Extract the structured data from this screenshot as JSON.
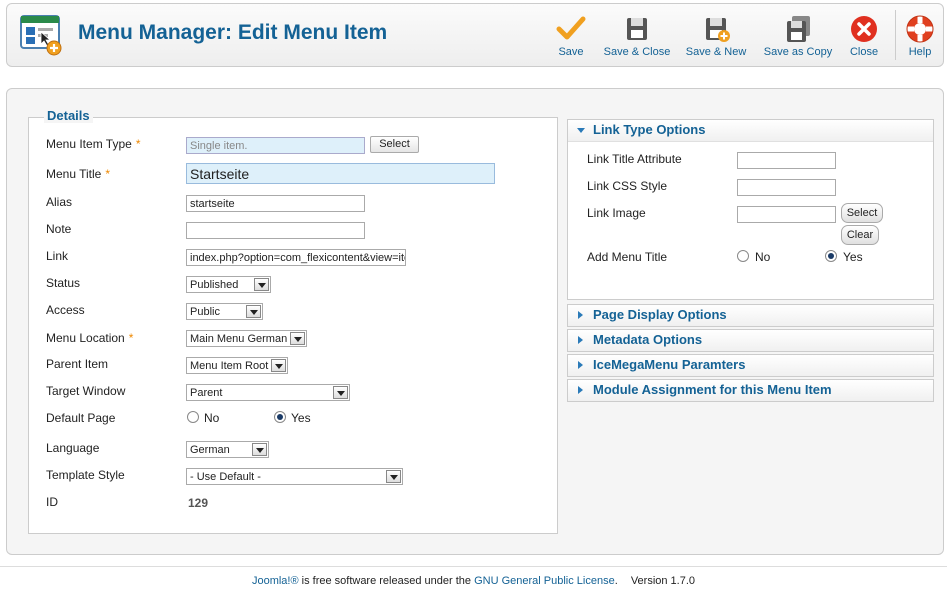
{
  "header": {
    "title": "Menu Manager: Edit Menu Item",
    "buttons": {
      "save": "Save",
      "save_close": "Save & Close",
      "save_new": "Save & New",
      "save_copy": "Save as Copy",
      "close": "Close",
      "help": "Help"
    }
  },
  "details": {
    "legend": "Details",
    "menu_item_type": {
      "label": "Menu Item Type",
      "value": "Single item.",
      "button": "Select"
    },
    "menu_title": {
      "label": "Menu Title",
      "value": "Startseite"
    },
    "alias": {
      "label": "Alias",
      "value": "startseite"
    },
    "note": {
      "label": "Note",
      "value": ""
    },
    "link": {
      "label": "Link",
      "value": "index.php?option=com_flexicontent&view=item"
    },
    "status": {
      "label": "Status",
      "value": "Published"
    },
    "access": {
      "label": "Access",
      "value": "Public"
    },
    "menu_location": {
      "label": "Menu Location",
      "value": "Main Menu German"
    },
    "parent_item": {
      "label": "Parent Item",
      "value": "Menu Item Root"
    },
    "target_window": {
      "label": "Target Window",
      "value": "Parent"
    },
    "default_page": {
      "label": "Default Page",
      "no": "No",
      "yes": "Yes",
      "selected": "Yes"
    },
    "language": {
      "label": "Language",
      "value": "German"
    },
    "template_style": {
      "label": "Template Style",
      "value": "- Use Default -"
    },
    "id": {
      "label": "ID",
      "value": "129"
    },
    "required_mark": "*"
  },
  "link_type": {
    "heading": "Link Type Options",
    "title_attribute": {
      "label": "Link Title Attribute",
      "value": ""
    },
    "css_style": {
      "label": "Link CSS Style",
      "value": ""
    },
    "image": {
      "label": "Link Image",
      "value": "",
      "select": "Select",
      "clear": "Clear"
    },
    "add_menu_title": {
      "label": "Add Menu Title",
      "no": "No",
      "yes": "Yes",
      "selected": "Yes"
    }
  },
  "panels": [
    "Page Display Options",
    "Metadata Options",
    "IceMegaMenu Paramters",
    "Module Assignment for this Menu Item"
  ],
  "footer": {
    "joomla": "Joomla!®",
    "text1": " is free software released under the ",
    "license": "GNU General Public License",
    "text2": ".",
    "version": "Version 1.7.0"
  },
  "colors": {
    "accent": "#146295",
    "save_check": "#f0a020",
    "close_red": "#e03020"
  }
}
